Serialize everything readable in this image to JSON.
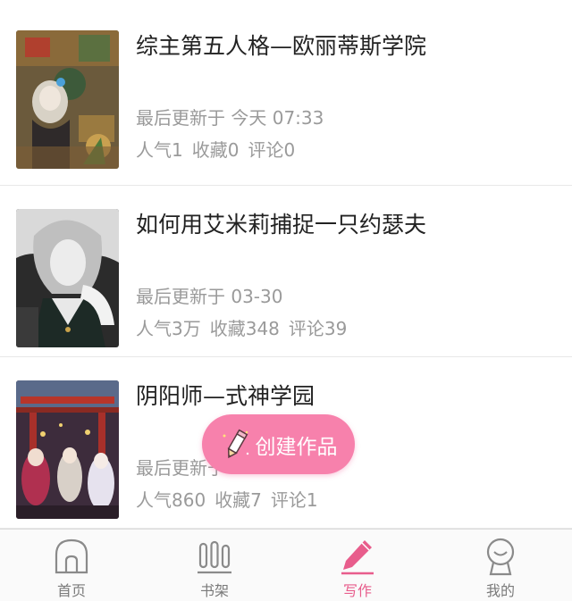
{
  "works": [
    {
      "title": "综主第五人格—欧丽蒂斯学院",
      "updated": "最后更新于 今天 07:33",
      "popularity": "人气1",
      "favorites": "收藏0",
      "comments": "评论0"
    },
    {
      "title": "如何用艾米莉捕捉一只约瑟夫",
      "updated": "最后更新于 03-30",
      "popularity": "人气3万",
      "favorites": "收藏348",
      "comments": "评论39"
    },
    {
      "title": "阴阳师—式神学园",
      "updated": "最后更新于",
      "popularity": "人气860",
      "favorites": "收藏7",
      "comments": "评论1"
    }
  ],
  "fab": {
    "label": "创建作品",
    "icon": "pencil-icon",
    "color": "#f781ac"
  },
  "tabbar": {
    "accent": "#e85d8c",
    "tabs": [
      {
        "label": "首页",
        "icon": "home-icon"
      },
      {
        "label": "书架",
        "icon": "bookshelf-icon"
      },
      {
        "label": "写作",
        "icon": "pencil-icon",
        "active": true
      },
      {
        "label": "我的",
        "icon": "profile-icon"
      }
    ]
  }
}
